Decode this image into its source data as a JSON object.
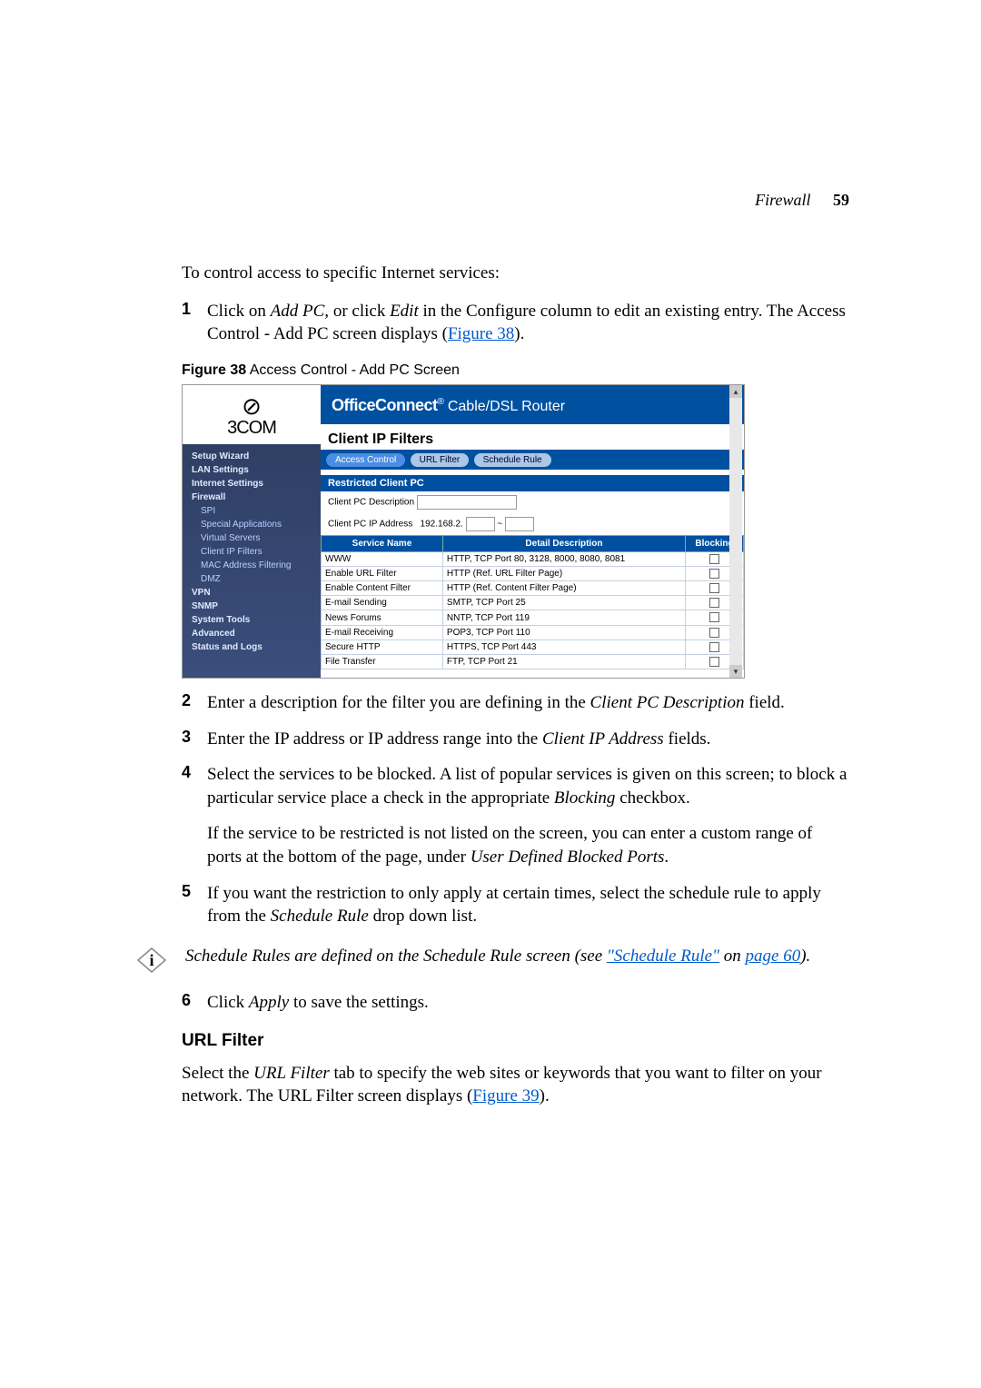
{
  "header": {
    "section": "Firewall",
    "page_num": "59"
  },
  "intro": "To control access to specific Internet services:",
  "step1": {
    "n": "1",
    "pre": "Click on ",
    "addpc": "Add PC,",
    "mid": " or click ",
    "edit": "Edit",
    "post": " in the Configure column to edit an existing entry. The Access Control - Add PC screen displays (",
    "figref": "Figure 38",
    "post2": ")."
  },
  "fig_caption": {
    "label": "Figure 38",
    "title": "   Access Control - Add PC Screen"
  },
  "shot": {
    "logo": "3COM",
    "nav": [
      "Setup Wizard",
      "LAN Settings",
      "Internet Settings",
      "Firewall",
      "SPI",
      "Special Applications",
      "Virtual Servers",
      "Client IP Filters",
      "MAC Address Filtering",
      "DMZ",
      "VPN",
      "SNMP",
      "System Tools",
      "Advanced",
      "Status and Logs"
    ],
    "oc_brand": "OfficeConnect",
    "oc_sub": " Cable/DSL Router",
    "cip_title": "Client IP Filters",
    "tabs": [
      "Access Control",
      "URL Filter",
      "Schedule Rule"
    ],
    "section_restricted": "Restricted Client PC",
    "field_desc_label": "Client PC Description",
    "field_ip_label": "Client PC IP Address",
    "field_ip_prefix": "192.168.2.",
    "tilde": "~",
    "th": {
      "svc": "Service Name",
      "desc": "Detail Description",
      "blk": "Blocking"
    },
    "rows": [
      {
        "svc": "WWW",
        "desc": "HTTP, TCP Port 80, 3128, 8000, 8080, 8081"
      },
      {
        "svc": "Enable URL Filter",
        "desc": "HTTP (Ref. URL Filter Page)"
      },
      {
        "svc": "Enable Content Filter",
        "desc": "HTTP (Ref. Content Filter Page)"
      },
      {
        "svc": "E-mail Sending",
        "desc": "SMTP, TCP Port 25"
      },
      {
        "svc": "News Forums",
        "desc": "NNTP, TCP Port 119"
      },
      {
        "svc": "E-mail Receiving",
        "desc": "POP3, TCP Port 110"
      },
      {
        "svc": "Secure HTTP",
        "desc": "HTTPS, TCP Port 443"
      },
      {
        "svc": "File Transfer",
        "desc": "FTP, TCP Port 21"
      }
    ]
  },
  "step2": {
    "n": "2",
    "pre": "Enter a description for the filter you are defining in the ",
    "em1": "Client PC Description",
    "post": " field."
  },
  "step3": {
    "n": "3",
    "pre": "Enter the IP address or IP address range into the ",
    "em1": "Client IP Address",
    "post": " fields."
  },
  "step4": {
    "n": "4",
    "pre": "Select the services to be blocked. A list of popular services is given on this screen; to block a particular service place a check in the appropriate ",
    "em1": "Blocking",
    "post": " checkbox."
  },
  "step4b": {
    "pre": "If the service to be restricted is not listed on the screen, you can enter a custom range of ports at the bottom of the page, under ",
    "em1": "User Defined Blocked Ports",
    "post": "."
  },
  "step5": {
    "n": "5",
    "pre": "If you want the restriction to only apply at certain times, select the schedule rule to apply from the ",
    "em1": "Schedule Rule",
    "post": " drop down list."
  },
  "note": {
    "pre": "Schedule Rules are defined on the Schedule Rule screen (see ",
    "lnk1": "\"Schedule Rule\"",
    "mid": " on ",
    "lnk2": "page 60",
    "post": ")."
  },
  "step6": {
    "n": "6",
    "pre": "Click ",
    "em1": "Apply",
    "post": " to save the settings."
  },
  "url_filter": {
    "heading": "URL Filter",
    "body_pre": "Select the ",
    "body_em": "URL Filter",
    "body_mid": " tab to specify the web sites or keywords that you want to filter on your network. The URL Filter screen displays (",
    "body_link": "Figure 39",
    "body_post": ")."
  }
}
